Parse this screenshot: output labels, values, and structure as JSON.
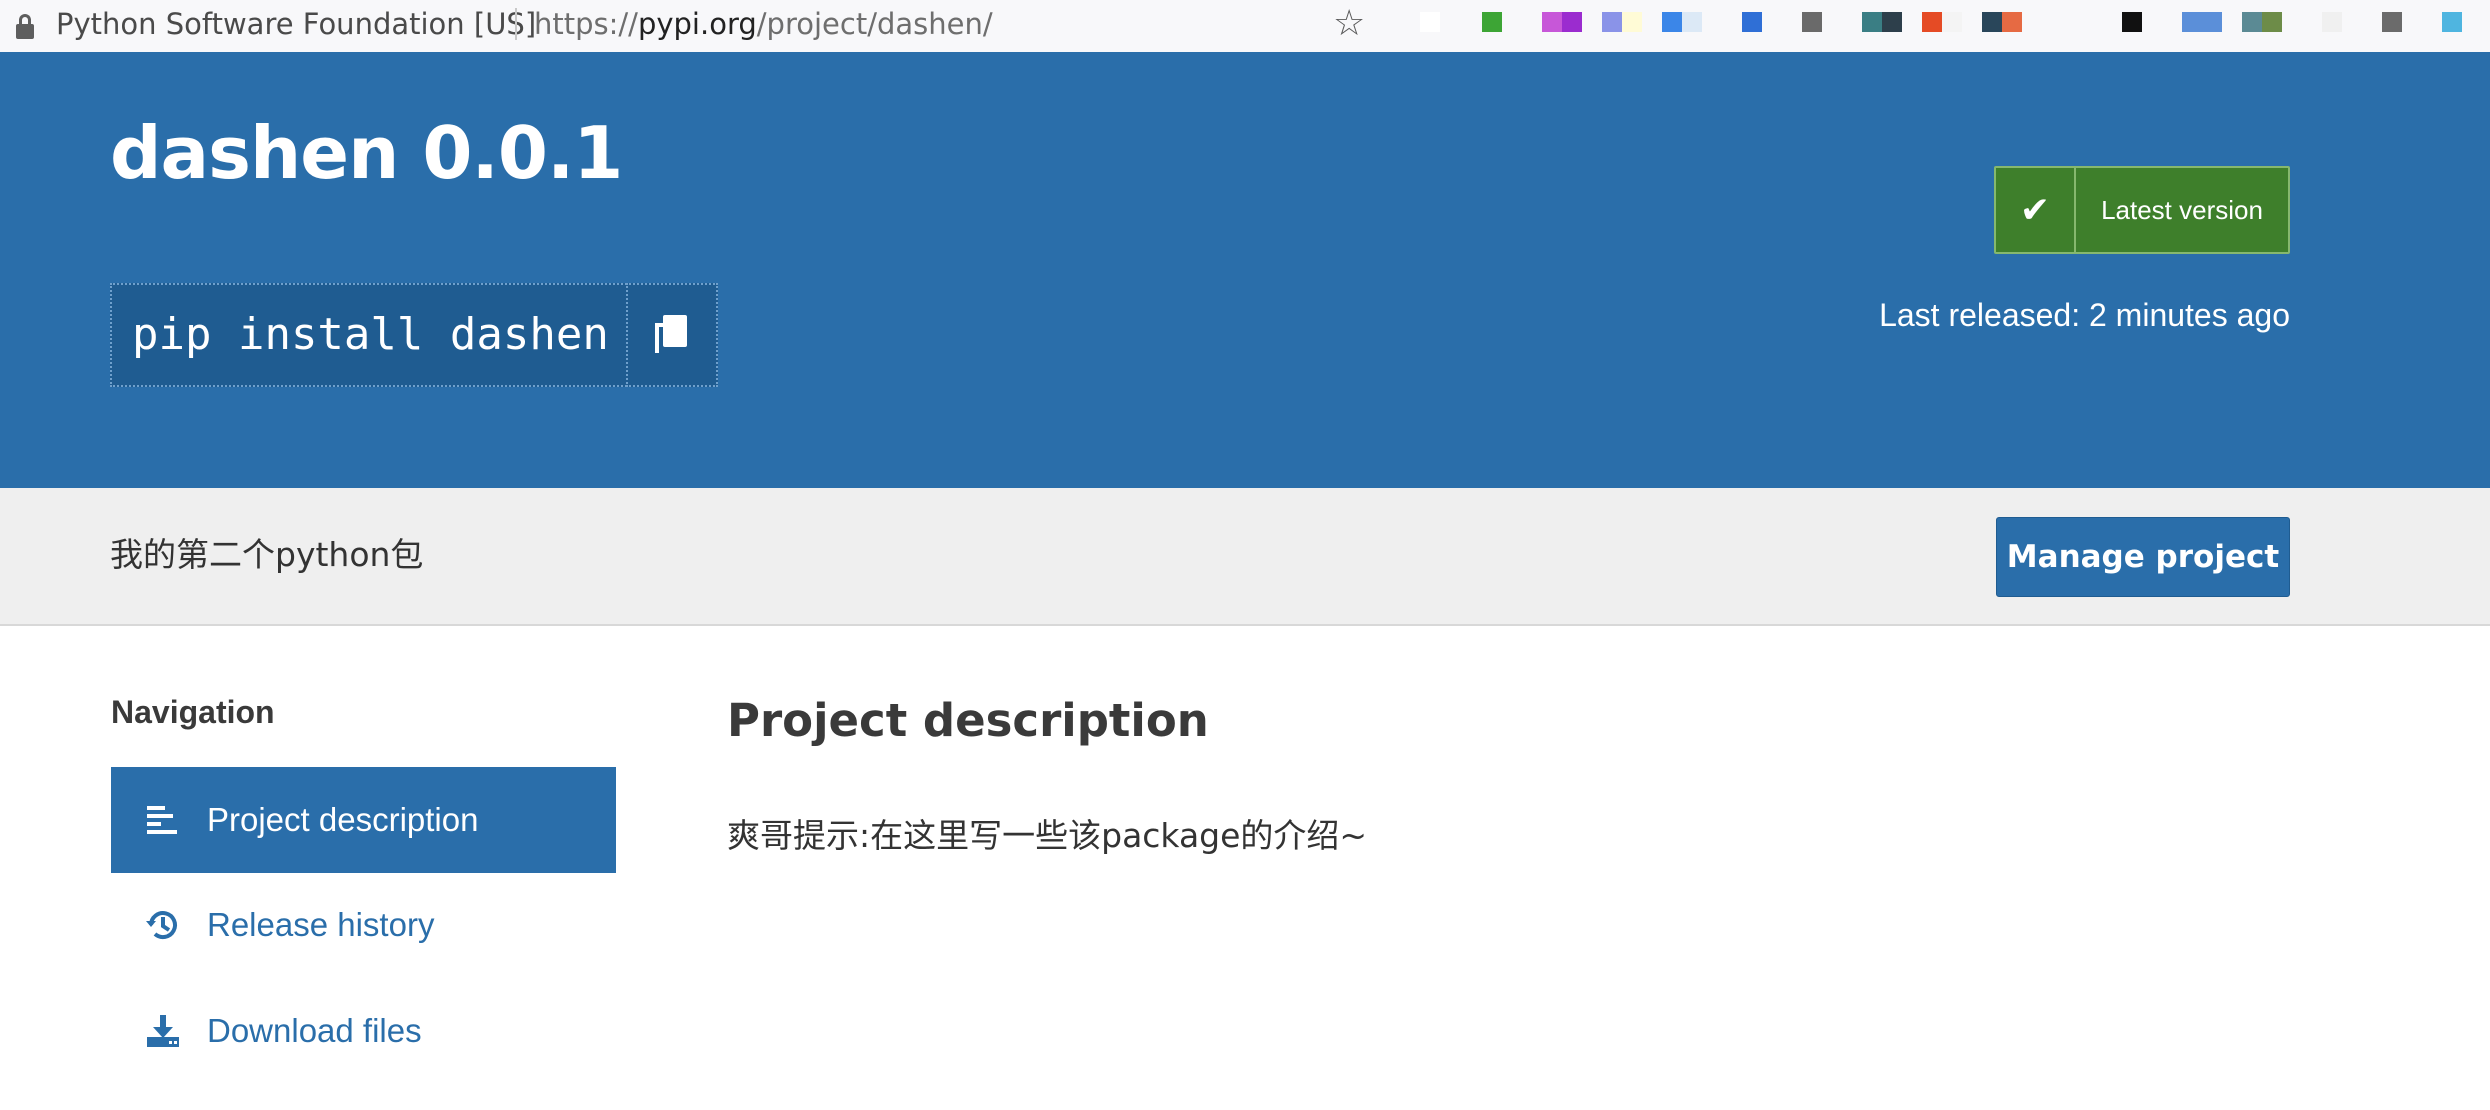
{
  "browser": {
    "site_owner": "Python Software Foundation [US]",
    "url_scheme": "https://",
    "url_host": "pypi.org",
    "url_path": "/project/dashen/",
    "extension_colors": [
      "#ffffff",
      "#3da535",
      "#c757d8",
      "#9b2ccf",
      "#8a93e8",
      "#fffbd6",
      "#3b86e8",
      "#dce9f6",
      "#2f6fd6",
      "#6a6a6a",
      "#3a7e84",
      "#2d3f4b",
      "#e54b25",
      "#f4f4f4",
      "#29465a",
      "#e66a43",
      "#111111",
      "#5b8fd9",
      "#5b8a94",
      "#6d8c48",
      "#f0f0f0",
      "#6b6b6b",
      "#4fb5e0"
    ]
  },
  "hero": {
    "title": "dashen 0.0.1",
    "pip_command": "pip install dashen",
    "latest_label": "Latest version",
    "last_released": "Last released: 2 minutes ago",
    "background_color": "#2a6eaa",
    "badge_color": "#3e7f2b"
  },
  "summary": {
    "text": "我的第二个python包",
    "manage_label": "Manage project"
  },
  "nav": {
    "heading": "Navigation",
    "items": [
      {
        "label": "Project description",
        "icon": "align-left-icon",
        "active": true
      },
      {
        "label": "Release history",
        "icon": "history-icon",
        "active": false
      },
      {
        "label": "Download files",
        "icon": "download-icon",
        "active": false
      }
    ]
  },
  "main": {
    "heading": "Project description",
    "body": "爽哥提示:在这里写一些该package的介绍~"
  }
}
